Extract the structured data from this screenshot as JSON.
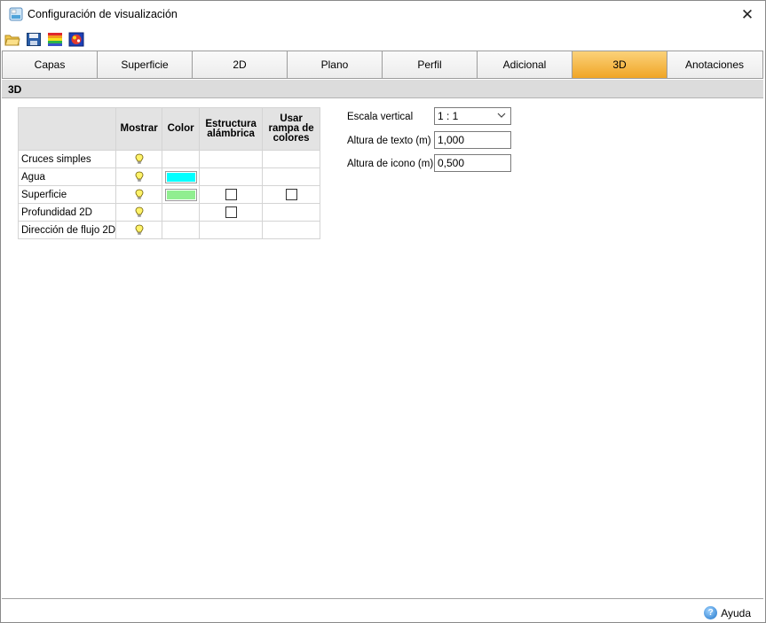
{
  "window": {
    "title": "Configuración de visualización",
    "close_glyph": "✕"
  },
  "toolbar": {
    "buttons": [
      {
        "name": "open-folder-icon"
      },
      {
        "name": "save-icon"
      },
      {
        "name": "color-ramp-icon"
      },
      {
        "name": "palette-icon"
      }
    ]
  },
  "tabs": [
    {
      "label": "Capas",
      "active": false
    },
    {
      "label": "Superficie",
      "active": false
    },
    {
      "label": "2D",
      "active": false
    },
    {
      "label": "Plano",
      "active": false
    },
    {
      "label": "Perfil",
      "active": false
    },
    {
      "label": "Adicional",
      "active": false
    },
    {
      "label": "3D",
      "active": true
    },
    {
      "label": "Anotaciones",
      "active": false
    }
  ],
  "section": {
    "title": "3D"
  },
  "grid": {
    "headers": {
      "mostrar": "Mostrar",
      "color": "Color",
      "estructura_1": "Estructura",
      "estructura_2": "alámbrica",
      "rampa_1": "Usar",
      "rampa_2": "rampa de",
      "rampa_3": "colores"
    },
    "rows": [
      {
        "label": "Cruces simples",
        "show": true,
        "color": null,
        "wireframe": null,
        "ramp": null
      },
      {
        "label": "Agua",
        "show": true,
        "color": "#00ffff",
        "wireframe": null,
        "ramp": null
      },
      {
        "label": "Superficie",
        "show": true,
        "color": "#90ee90",
        "wireframe": false,
        "ramp": false
      },
      {
        "label": "Profundidad 2D",
        "show": true,
        "color": null,
        "wireframe": false,
        "ramp": null
      },
      {
        "label": "Dirección de flujo 2D",
        "show": true,
        "color": null,
        "wireframe": null,
        "ramp": null
      }
    ]
  },
  "props": {
    "vertical_scale_label": "Escala vertical",
    "vertical_scale_value": "1 : 1",
    "text_height_label": "Altura de texto (m)",
    "text_height_value": "1,000",
    "icon_height_label": "Altura de icono (m)",
    "icon_height_value": "0,500"
  },
  "footer": {
    "help_label": "Ayuda",
    "help_glyph": "?"
  },
  "colors": {
    "active_tab": "#f5b23a",
    "section_bg": "#dcdcdc",
    "header_bg": "#e3e3e3"
  }
}
